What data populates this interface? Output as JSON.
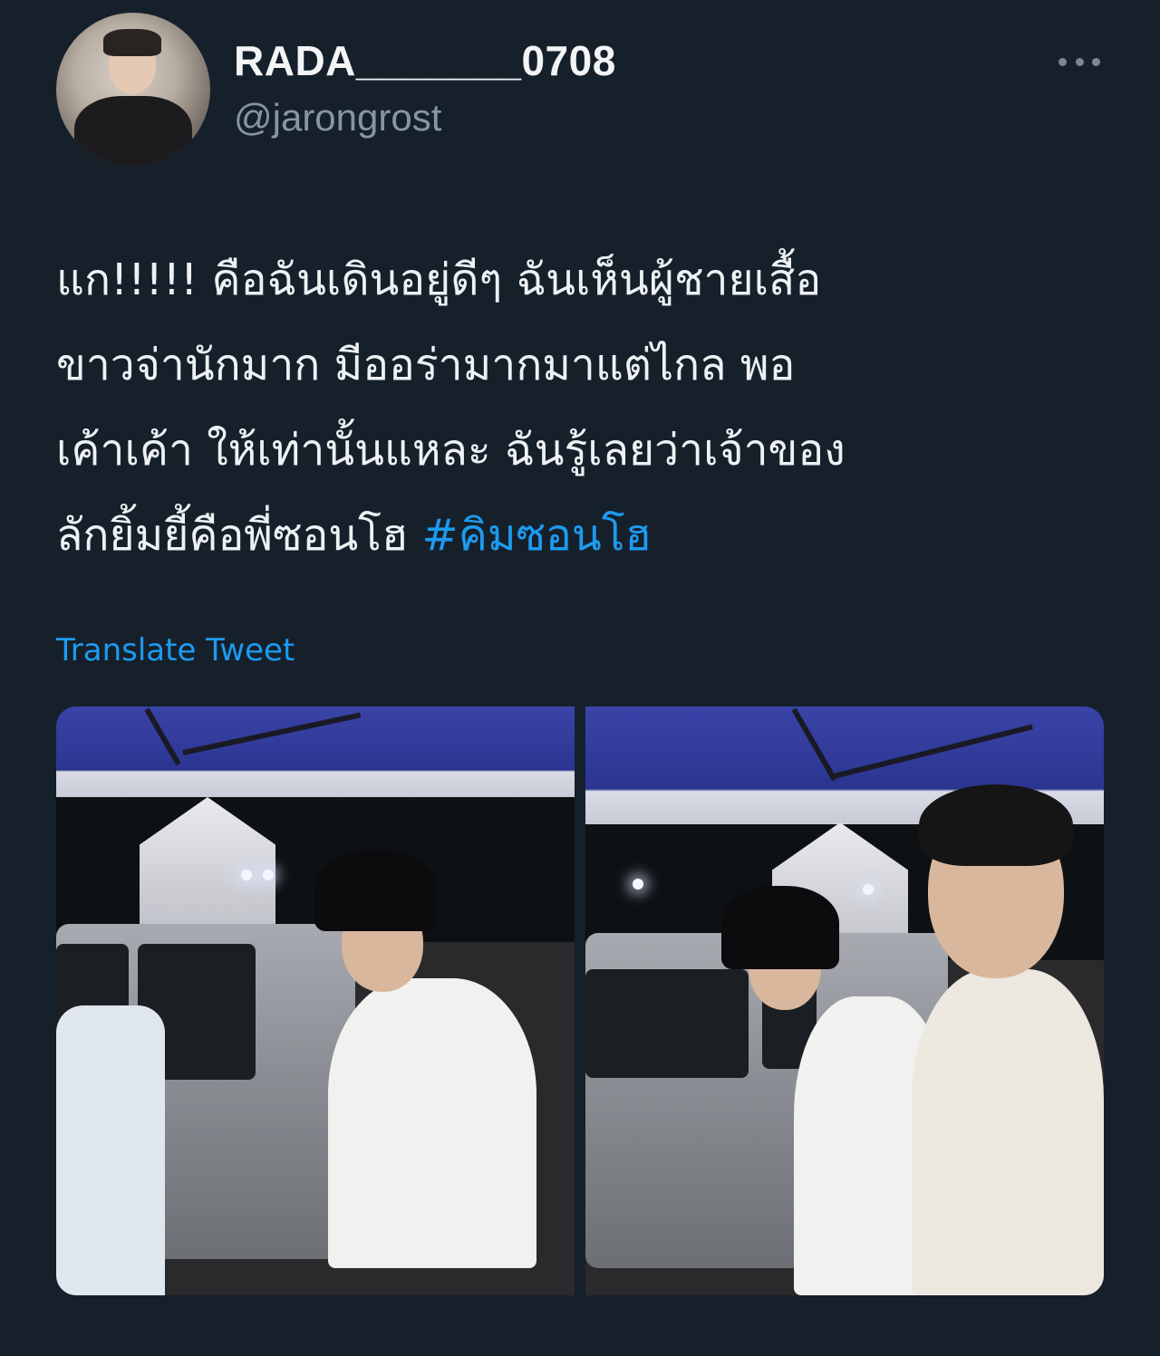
{
  "tweet": {
    "author": {
      "display_name": "RADA_______0708",
      "handle": "@jarongrost",
      "avatar": "profile-photo"
    },
    "more_icon": "more-horizontal-icon",
    "text_lines": [
      "แก!!!!! คือฉันเดินอยู่ดีๆ ฉันเห็นผู้ชายเสื้อ",
      "ขาวจ่านักมาก มีออร่ามากมาแต่ไกล พอ",
      "เค้าเค้า ให้เท่านั้นแหละ ฉันรู้เลยว่าเจ้าของ",
      "ลักยิ้มยี้คือพี่ซอนโฮ "
    ],
    "hashtag": "#คิมซอนโฮ",
    "translate_label": "Translate Tweet",
    "link_color": "#1d9bf0",
    "background": "#16202b",
    "media": [
      {
        "name": "photo-1"
      },
      {
        "name": "photo-2"
      }
    ]
  }
}
